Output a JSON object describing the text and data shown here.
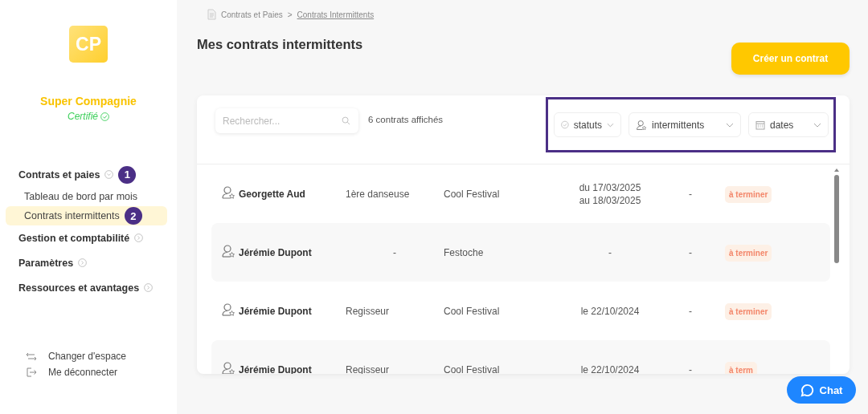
{
  "sidebar": {
    "logo": "CP",
    "company": "Super Compagnie",
    "certification": "Certifié",
    "nav": [
      {
        "label": "Contrats et paies",
        "expanded": true,
        "annotation": "1",
        "children": [
          {
            "label": "Tableau de bord par mois",
            "selected": false
          },
          {
            "label": "Contrats intermittents",
            "selected": true,
            "annotation": "2"
          }
        ]
      },
      {
        "label": "Gestion et comptabilité",
        "expanded": false
      },
      {
        "label": "Paramètres",
        "expanded": false
      },
      {
        "label": "Ressources et avantages",
        "expanded": false
      }
    ],
    "footer": [
      {
        "kind": "switch",
        "label": "Changer d'espace"
      },
      {
        "kind": "logout",
        "label": "Me déconnecter"
      }
    ]
  },
  "breadcrumb": {
    "separator": ">",
    "items": [
      "Contrats et Paies",
      "Contrats Intermittents"
    ]
  },
  "title": "Mes contrats intermittents",
  "create_button": "Créer un contrat",
  "search": {
    "placeholder": "Rechercher..."
  },
  "count": "6 contrats affichés",
  "filters": {
    "highlighted": true,
    "items": [
      {
        "kind": "status",
        "label": "statuts"
      },
      {
        "kind": "person",
        "label": "intermittents"
      },
      {
        "kind": "calendar",
        "label": "dates"
      }
    ]
  },
  "rows": [
    {
      "name": "Georgette Aud",
      "role": "1ère danseuse",
      "project": "Cool Festival",
      "dates": [
        "du 17/03/2025",
        "au 18/03/2025"
      ],
      "column_5": "-",
      "status": "à terminer"
    },
    {
      "name": "Jérémie Dupont",
      "role": "-",
      "project": "Festoche",
      "dates": [
        "-"
      ],
      "column_5": "-",
      "status": "à terminer"
    },
    {
      "name": "Jérémie Dupont",
      "role": "Regisseur",
      "project": "Cool Festival",
      "dates": [
        "le 22/10/2024"
      ],
      "column_5": "-",
      "status": "à terminer"
    },
    {
      "name": "Jérémie Dupont",
      "role": "Regisseur",
      "project": "Cool Festival",
      "dates": [
        "le 22/10/2024"
      ],
      "column_5": "-",
      "status": "à term"
    }
  ],
  "chat": "Chat"
}
